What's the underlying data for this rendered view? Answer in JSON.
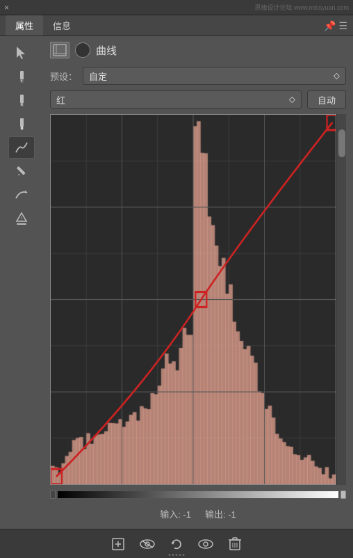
{
  "titlebar": {
    "close_icon": "×",
    "watermark": "思缘设计论坛 www.missyuan.com"
  },
  "tabs": [
    {
      "label": "属性",
      "active": true
    },
    {
      "label": "信息",
      "active": false
    }
  ],
  "tabs_menu_icon": "☰",
  "panel": {
    "icon1_symbol": "⊡",
    "icon2_type": "circle",
    "title": "曲线"
  },
  "preset": {
    "label": "预设：",
    "value": "自定",
    "arrow": "⬦"
  },
  "channel": {
    "value": "红",
    "arrow": "⬦"
  },
  "auto_button": "自动",
  "tools": [
    {
      "name": "pointer",
      "symbol": "↗",
      "active": false
    },
    {
      "name": "eyedropper1",
      "symbol": "🖈",
      "active": false
    },
    {
      "name": "eyedropper2",
      "symbol": "🖈",
      "active": false
    },
    {
      "name": "eyedropper3",
      "symbol": "🖈",
      "active": false
    },
    {
      "name": "curve-draw",
      "symbol": "∿",
      "active": true
    },
    {
      "name": "pencil",
      "symbol": "✏",
      "active": false
    },
    {
      "name": "spline",
      "symbol": "⋰",
      "active": false
    },
    {
      "name": "warning",
      "symbol": "⚠",
      "active": false
    }
  ],
  "input_output": {
    "input_label": "输入: -1",
    "output_label": "输出: -1"
  },
  "bottom_toolbar": {
    "btn1": "⊡",
    "btn2": "👁",
    "btn3": "↺",
    "btn4": "👁",
    "btn5": "🗑"
  },
  "curve": {
    "grid_color": "#555",
    "histogram_color": "rgba(255,180,160,0.6)",
    "curve_color": "#cc2222",
    "control_point_color": "#cc2222",
    "control_points": [
      {
        "x": 0.02,
        "y": 0.98
      },
      {
        "x": 0.52,
        "y": 0.52
      },
      {
        "x": 0.99,
        "y": 0.01
      }
    ]
  }
}
